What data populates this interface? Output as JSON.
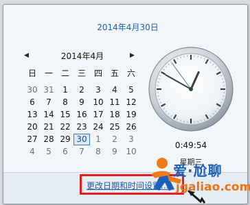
{
  "header": {
    "full_date": "2014年4月30日"
  },
  "calendar": {
    "month_title": "2014年4月",
    "prev_arrow": "◀",
    "next_arrow": "▶",
    "weekdays": [
      "日",
      "一",
      "二",
      "三",
      "四",
      "五",
      "六"
    ],
    "weeks": [
      [
        "30",
        "31",
        "1",
        "2",
        "3",
        "4",
        "5"
      ],
      [
        "6",
        "7",
        "8",
        "9",
        "10",
        "11",
        "12"
      ],
      [
        "13",
        "14",
        "15",
        "16",
        "17",
        "18",
        "19"
      ],
      [
        "20",
        "21",
        "22",
        "23",
        "24",
        "25",
        "26"
      ],
      [
        "27",
        "28",
        "29",
        "30",
        "1",
        "2",
        "3"
      ],
      [
        "4",
        "5",
        "6",
        "7",
        "8",
        "9",
        "10"
      ]
    ],
    "selected_day": "30"
  },
  "clock": {
    "time_text": "0:49:54",
    "weekday_text": "星期三",
    "hour": 0,
    "minute": 49,
    "second": 54
  },
  "footer": {
    "settings_link": "更改日期和时间设置..."
  },
  "watermark": {
    "brand": "爱·尬聊",
    "url": "jgaliao.com"
  },
  "colors": {
    "link": "#1e5ea8",
    "highlight_box": "#e02020",
    "today_border": "#3b78c8"
  }
}
